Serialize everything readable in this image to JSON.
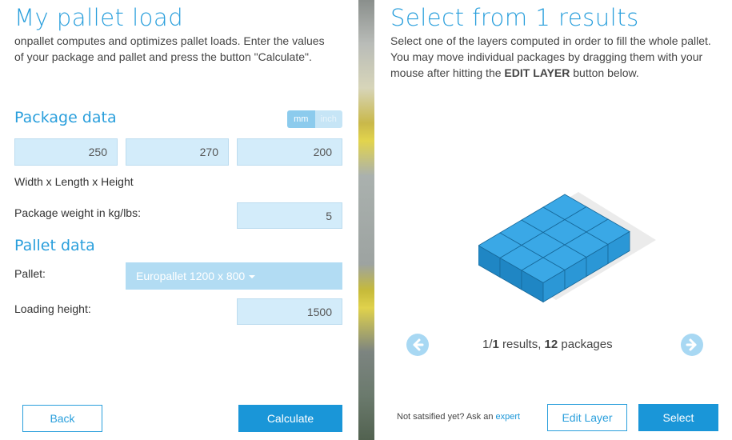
{
  "left": {
    "title": "My pallet load",
    "intro": "onpallet computes and optimizes pallet loads. Enter the values of your package and pallet and press the button \"Calculate\".",
    "package_heading": "Package data",
    "units": [
      "mm",
      "inch"
    ],
    "width_value": "250",
    "length_value": "270",
    "height_value": "200",
    "dims_label": "Width x Length x Height",
    "weight_label": "Package weight in kg/lbs:",
    "weight_value": "5",
    "pallet_heading": "Pallet data",
    "pallet_label": "Pallet:",
    "pallet_select": "Europallet 1200 x 800",
    "loading_label": "Loading height:",
    "loading_value": "1500",
    "back_label": "Back",
    "calculate_label": "Calculate"
  },
  "right": {
    "title": "Select from 1 results",
    "intro_part1": "Select one of the layers computed in order to fill the whole pallet. You may move individual packages by dragging them with your mouse after hitting the ",
    "intro_bold": "EDIT LAYER",
    "intro_part2": " button below.",
    "result_index": "1/",
    "result_total": "1",
    "result_mid": " results, ",
    "package_count": "12",
    "package_suffix": " packages",
    "not_satisfied": "Not satsified yet? Ask an ",
    "expert_link": "expert",
    "edit_layer_label": "Edit Layer",
    "select_label": "Select"
  },
  "colors": {
    "accent": "#2a9fdc",
    "box_top": "#3aa8e6",
    "box_left": "#1f86c4",
    "box_right": "#2b97d6"
  }
}
